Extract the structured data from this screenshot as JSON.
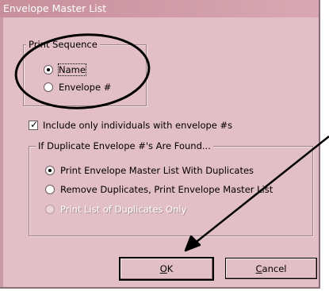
{
  "window": {
    "title": "Envelope Master List"
  },
  "print_sequence": {
    "legend": "Print Sequence",
    "options": [
      {
        "label": "Name",
        "selected": true
      },
      {
        "label": "Envelope #",
        "selected": false
      }
    ]
  },
  "include_only": {
    "label": "Include only individuals with envelope #s",
    "checked": true
  },
  "duplicates": {
    "legend": "If Duplicate Envelope #'s Are Found...",
    "options": [
      {
        "label": "Print Envelope Master List With Duplicates",
        "selected": true,
        "enabled": true
      },
      {
        "label": "Remove Duplicates, Print Envelope Master List",
        "selected": false,
        "enabled": true
      },
      {
        "label": "Print List of Duplicates Only",
        "selected": false,
        "enabled": false
      }
    ]
  },
  "buttons": {
    "ok": {
      "mnemonic": "O",
      "rest": "K"
    },
    "cancel": {
      "mnemonic": "C",
      "rest": "ancel"
    }
  },
  "annotations": {
    "circle_color": "#000000",
    "arrow_color": "#000000"
  }
}
